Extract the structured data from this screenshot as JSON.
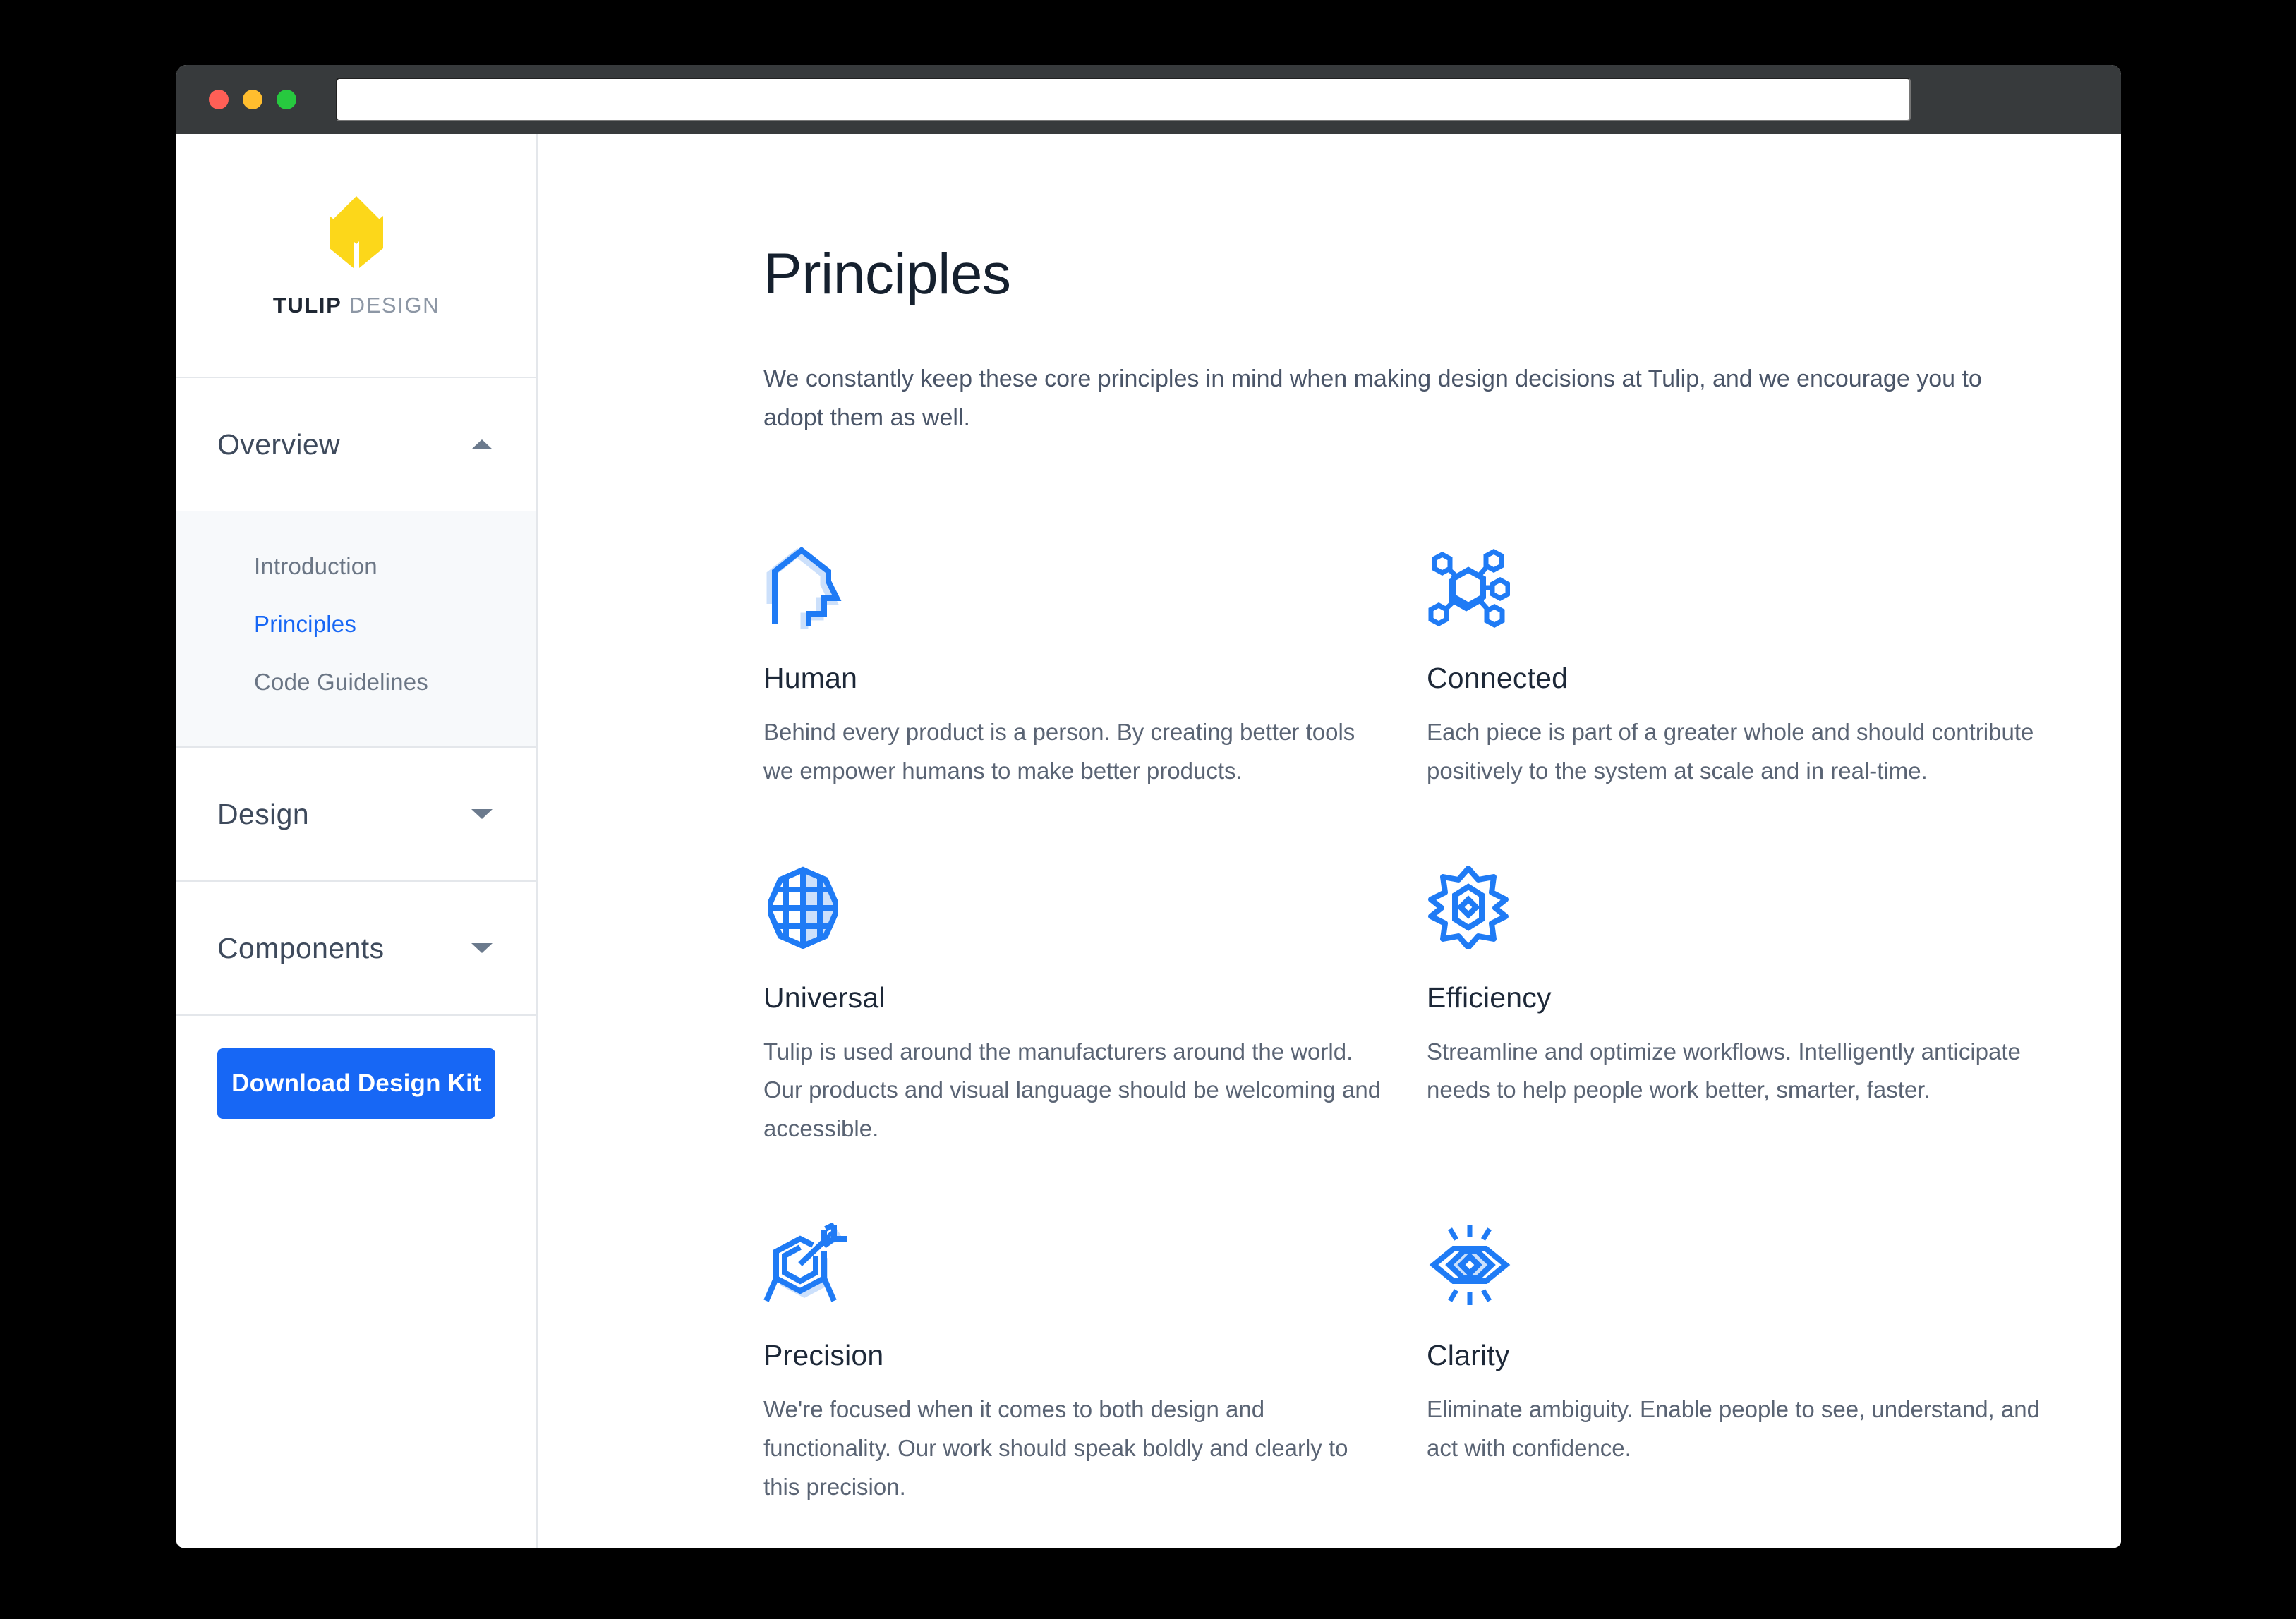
{
  "window": {
    "traffic_lights": [
      "close",
      "minimize",
      "maximize"
    ],
    "url_value": "",
    "url_placeholder": ""
  },
  "brand": {
    "name_bold": "TULIP",
    "name_light": " DESIGN",
    "logo_color": "#fcd71a",
    "logo_icon": "tulip-logo-icon"
  },
  "sidebar": {
    "sections": [
      {
        "label": "Overview",
        "expanded": true,
        "caret": "chevron-up-icon",
        "items": [
          {
            "label": "Introduction",
            "active": false
          },
          {
            "label": "Principles",
            "active": true
          },
          {
            "label": "Code Guidelines",
            "active": false
          }
        ]
      },
      {
        "label": "Design",
        "expanded": false,
        "caret": "chevron-down-icon",
        "items": []
      },
      {
        "label": "Components",
        "expanded": false,
        "caret": "chevron-down-icon",
        "items": []
      }
    ],
    "download_button": "Download Design Kit",
    "accent_color": "#1767f5"
  },
  "main": {
    "title": "Principles",
    "intro": "We constantly keep these core principles in mind when making design decisions at Tulip, and we encourage you to adopt them as well.",
    "principles": [
      {
        "icon": "head-profile-icon",
        "title": "Human",
        "desc": "Behind every product is a person. By creating better tools we empower humans to make better products."
      },
      {
        "icon": "network-nodes-icon",
        "title": "Connected",
        "desc": "Each piece is part of a greater whole and should contribute positively to the system at scale and in real-time."
      },
      {
        "icon": "globe-grid-icon",
        "title": "Universal",
        "desc": "Tulip is used around the manufacturers around the world. Our products and visual language should be welcoming and accessible."
      },
      {
        "icon": "gear-icon",
        "title": "Efficiency",
        "desc": "Streamline and optimize workflows. Intelligently anticipate needs to help people work better, smarter, faster."
      },
      {
        "icon": "target-arrow-icon",
        "title": "Precision",
        "desc": "We're focused when it comes to both design and functionality. Our work should speak boldly and clearly to this precision."
      },
      {
        "icon": "eye-rays-icon",
        "title": "Clarity",
        "desc": "Eliminate ambiguity. Enable people to see, understand, and act with confidence."
      }
    ],
    "icon_stroke_color": "#1f7bf5",
    "icon_fill_color": "#cce0fb"
  }
}
